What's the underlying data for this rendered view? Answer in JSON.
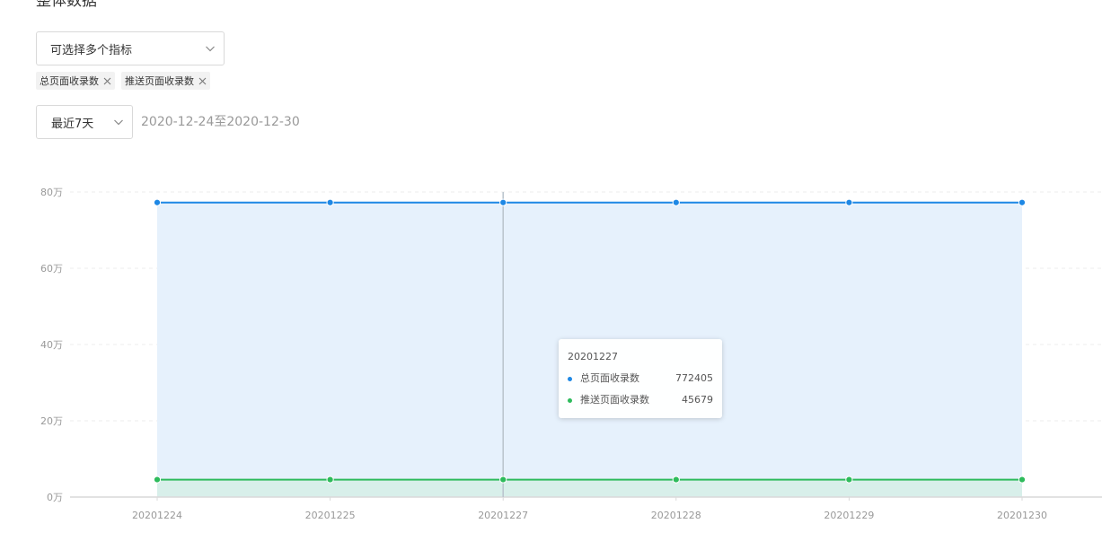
{
  "section": {
    "title": "整体数据"
  },
  "metric_select": {
    "placeholder": "可选择多个指标",
    "icon": "chevron-down-icon"
  },
  "selected_tags": [
    {
      "label": "总页面收录数",
      "icon": "close-icon"
    },
    {
      "label": "推送页面收录数",
      "icon": "close-icon"
    }
  ],
  "range_select": {
    "value": "最近7天",
    "icon": "chevron-down-icon"
  },
  "date_range": "2020-12-24至2020-12-30",
  "colors": {
    "total": "#1e88e5",
    "total_fill": "#e6f1fc",
    "push": "#2ebb5c",
    "push_fill": "#d8efea",
    "grid": "#ececec",
    "axis": "#d9d9d9"
  },
  "chart_data": {
    "type": "area",
    "categories": [
      "20201224",
      "20201225",
      "20201227",
      "20201228",
      "20201229",
      "20201230"
    ],
    "ylim": [
      0,
      800000
    ],
    "y_ticks": [
      {
        "value": 0,
        "label": "0万"
      },
      {
        "value": 200000,
        "label": "20万"
      },
      {
        "value": 400000,
        "label": "40万"
      },
      {
        "value": 600000,
        "label": "60万"
      },
      {
        "value": 800000,
        "label": "80万"
      }
    ],
    "grid": true,
    "series": [
      {
        "name": "总页面收录数",
        "values": [
          772405,
          772405,
          772405,
          772405,
          772405,
          772405
        ]
      },
      {
        "name": "推送页面收录数",
        "values": [
          45679,
          45679,
          45679,
          45679,
          45679,
          45679
        ]
      }
    ],
    "tooltip": {
      "category": "20201227",
      "rows": [
        {
          "name": "总页面收录数",
          "value": "772405"
        },
        {
          "name": "推送页面收录数",
          "value": "45679"
        }
      ]
    }
  }
}
